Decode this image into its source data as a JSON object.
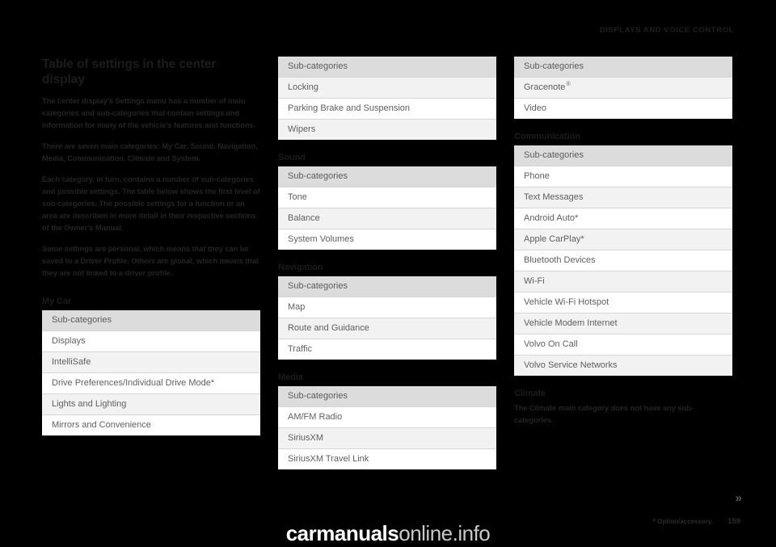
{
  "header": {
    "running_head": "DISPLAYS AND VOICE CONTROL"
  },
  "article": {
    "title": "Table of settings in the center display",
    "paragraphs": [
      "The center display's Settings menu has a number of main categories and sub-categories that contain settings and information for many of the vehicle's features and functions.",
      "There are seven main categories: My Car, Sound, Navigation, Media, Communication, Climate and System.",
      "Each category, in turn, contains a number of sub-categories and possible settings. The table below shows the first level of sub-categories. The possible settings for a function or an area are described in more detail in their respective sections of the Owner's Manual.",
      "Some settings are personal, which means that they can be saved to a Driver Profile. Others are global, which means that they are not linked to a driver profile."
    ],
    "paragraph_2_parts": [
      {
        "text": "There are seven main categories: ",
        "bold": false
      },
      {
        "text": "My Car",
        "bold": true
      },
      {
        "text": ", ",
        "bold": false
      },
      {
        "text": "Sound",
        "bold": true
      },
      {
        "text": ", ",
        "bold": false
      },
      {
        "text": "Navigation",
        "bold": true
      },
      {
        "text": ", ",
        "bold": false
      },
      {
        "text": "Media",
        "bold": true
      },
      {
        "text": ", ",
        "bold": false
      },
      {
        "text": "Communication",
        "bold": true
      },
      {
        "text": ", ",
        "bold": false
      },
      {
        "text": "Climate",
        "bold": true
      },
      {
        "text": " and ",
        "bold": false
      },
      {
        "text": "System",
        "bold": true
      },
      {
        "text": ".",
        "bold": false
      }
    ]
  },
  "column_header_label": "Sub-categories",
  "sections": {
    "my_car": {
      "heading": "My Car",
      "column_header": "Sub-categories",
      "rows_col1": [
        "Displays",
        "IntelliSafe",
        "Drive Preferences/Individual Drive Mode*",
        "Lights and Lighting",
        "Mirrors and Convenience"
      ],
      "rows_col2": [
        "Locking",
        "Parking Brake and Suspension",
        "Wipers"
      ]
    },
    "sound": {
      "heading": "Sound",
      "column_header": "Sub-categories",
      "rows": [
        "Tone",
        "Balance",
        "System Volumes"
      ]
    },
    "navigation": {
      "heading": "Navigation",
      "column_header": "Sub-categories",
      "rows": [
        "Map",
        "Route and Guidance",
        "Traffic"
      ]
    },
    "media": {
      "heading": "Media",
      "column_header": "Sub-categories",
      "rows_col2": [
        "AM/FM Radio",
        "SiriusXM",
        "SiriusXM Travel Link"
      ],
      "rows_col3": [
        "Gracenote®",
        "Video"
      ]
    },
    "communication": {
      "heading": "Communication",
      "column_header": "Sub-categories",
      "rows": [
        "Phone",
        "Text Messages",
        "Android Auto*",
        "Apple CarPlay*",
        "Bluetooth Devices",
        "Wi-Fi",
        "Vehicle Wi-Fi Hotspot",
        "Vehicle Modem Internet",
        "Volvo On Call",
        "Volvo Service Networks"
      ]
    },
    "climate": {
      "heading": "Climate",
      "body_prefix": "The ",
      "body_bold": "Climate",
      "body_suffix": " main category does not have any sub-categories."
    }
  },
  "footer": {
    "chevrons": "»",
    "option_note": "* Option/accessory.",
    "page_number": "159"
  },
  "watermark": {
    "primary": "carmanuals",
    "secondary": "online.info"
  },
  "colors": {
    "page_background": "#000000",
    "table_header_bg": "#dcdcdc",
    "table_row_odd_bg": "#f2f2f2",
    "table_row_even_bg": "#ffffff",
    "table_text": "#5f5f5f",
    "body_text": "#242424"
  }
}
